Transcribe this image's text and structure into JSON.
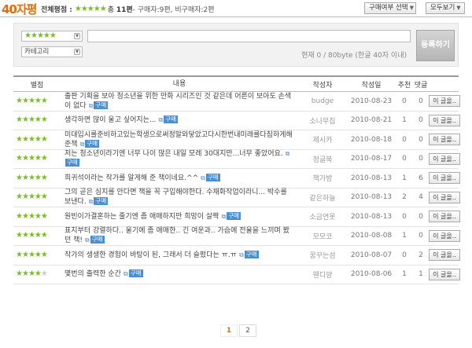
{
  "header": {
    "title": "40자평",
    "rating_label": "전체평점 :",
    "stars": 4.5,
    "total_prefix": "총",
    "total_count": "11편",
    "buyer_text": " - 구매자:9편, 비구매자:2편",
    "buy_select_label": "구매여부 선택",
    "view_all_label": "모두보기"
  },
  "write": {
    "stars_value": 5,
    "category_label": "카테고리",
    "text_value": "",
    "count_text": "현재 0 / 80byte (한글 40자 이내)",
    "submit_label": "등록하기"
  },
  "table": {
    "headers": {
      "rating": "별점",
      "content": "내용",
      "author": "작성자",
      "date": "작성일",
      "rec": "추천",
      "comments": "댓글"
    },
    "badge_label": "구매",
    "comment_btn_label": "이 글을..",
    "rows": [
      {
        "stars": 5,
        "content": "출판 기획을 보아 청소년을 위한 만화 시리즈인 것 같은데 어른이 보아도 손색이 없다",
        "author": "budge",
        "date": "2010-08-23",
        "rec": "0",
        "comments": "0"
      },
      {
        "stars": 5,
        "content": "생각하면 많이 울고 싶어지는...",
        "author": "소나무집",
        "date": "2010-08-21",
        "rec": "1",
        "comments": "0"
      },
      {
        "stars": 5,
        "content": "미대입시를준비하고있는학생으로써정말와닿았고다시한번내미래를다짐하게해준책",
        "author": "제시카",
        "date": "2010-08-18",
        "rec": "0",
        "comments": "0"
      },
      {
        "stars": 5,
        "content": "저는 청소년이라기엔 너무 나이 많은 내일 모레 30대지만...너무 좋았어요.",
        "author": "정글북",
        "date": "2010-08-17",
        "rec": "0",
        "comments": "0"
      },
      {
        "stars": 5,
        "content": "희귀석이라는 작가를 알게해 준 책이네요.^^",
        "author": "책가방",
        "date": "2010-08-13",
        "rec": "1",
        "comments": "6"
      },
      {
        "stars": 5,
        "content": "그의 곧은 심지를 안다면 책을 꼭 구입해야한다. 수채화작업이라니... 박수를 보낸다.",
        "author": "같은하늘",
        "date": "2010-08-13",
        "rec": "2",
        "comments": "4"
      },
      {
        "stars": 5,
        "content": "원빈이가결혼하는 줄기엔 좀 애매하지만 희망이 살짝",
        "author": "소금연못",
        "date": "2010-08-13",
        "rec": "0",
        "comments": "0"
      },
      {
        "stars": 5,
        "content": "표지부터 강렬하다.. 울기에 좀 애매한.. 긴 여운과.. 가슴에 전율을 느끼며 봤던 책!",
        "author": "모모코",
        "date": "2010-08-08",
        "rec": "1",
        "comments": "0"
      },
      {
        "stars": 5,
        "content": "작가의 생생한 경험이 바탕이 된, 그래서 더 슬펐다는 ㅠ.ㅠ",
        "author": "꿈꾸는섬",
        "date": "2010-08-07",
        "rec": "0",
        "comments": "2"
      },
      {
        "stars": 4,
        "content": "몇번의 출력한 순간",
        "author": "웬디양",
        "date": "2010-08-06",
        "rec": "1",
        "comments": "1"
      }
    ]
  },
  "pagination": {
    "pages": [
      "1",
      "2"
    ],
    "current": "1"
  },
  "colors": {
    "accent": "#e36d0c",
    "star": "#7dbb2b",
    "badge": "#4a8fcf"
  }
}
